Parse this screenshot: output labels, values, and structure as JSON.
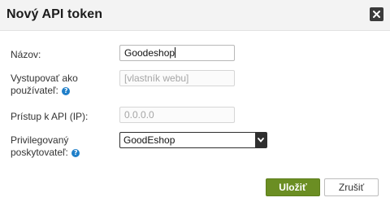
{
  "dialog": {
    "title": "Nový API token",
    "close_icon": "close-icon"
  },
  "form": {
    "name": {
      "label": "Názov:",
      "value": "Goodeshop"
    },
    "act_as": {
      "label_line1": "Vystupovať ako",
      "label_line2": "používateľ:",
      "placeholder": "[vlastník webu]",
      "help_icon": "help-icon"
    },
    "api_access": {
      "label": "Prístup k API (IP):",
      "placeholder": "0.0.0.0"
    },
    "privileged_provider": {
      "label_line1": "Privilegovaný",
      "label_line2": "poskytovateľ:",
      "selected": "GoodEshop",
      "help_icon": "help-icon",
      "arrow_icon": "chevron-down-icon"
    }
  },
  "buttons": {
    "save": "Uložiť",
    "cancel": "Zrušiť"
  },
  "colors": {
    "save_button": "#6b8e23",
    "help_icon": "#1f7fc9",
    "titlebar": "#f3f3f3"
  }
}
